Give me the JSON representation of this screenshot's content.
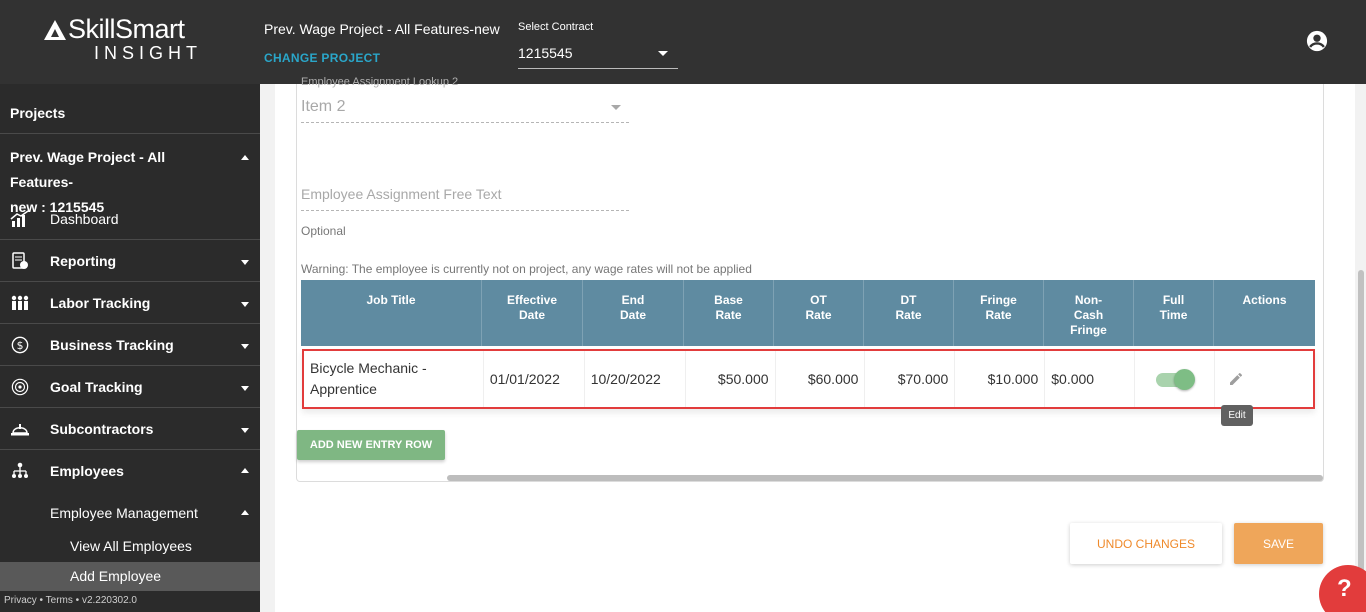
{
  "header": {
    "brand": "SkillSmart",
    "brand_sub": "INSIGHT",
    "project_title": "Prev. Wage Project - All Features-new",
    "change_project": "CHANGE PROJECT",
    "contract_label": "Select Contract",
    "contract_value": "1215545",
    "user_icon": "account-circle-icon"
  },
  "sidebar": {
    "projects_label": "Projects",
    "project_line1": "Prev. Wage Project - All Features-",
    "project_line2": "new : 1215545",
    "items": [
      {
        "label": "Dashboard",
        "icon": "dashboard-chart-icon"
      },
      {
        "label": "Reporting",
        "icon": "report-icon"
      },
      {
        "label": "Labor Tracking",
        "icon": "people-icon"
      },
      {
        "label": "Business Tracking",
        "icon": "dollar-icon"
      },
      {
        "label": "Goal Tracking",
        "icon": "target-icon"
      },
      {
        "label": "Subcontractors",
        "icon": "hardhat-icon"
      },
      {
        "label": "Employees",
        "icon": "org-chart-icon"
      }
    ],
    "employee_management": "Employee Management",
    "view_all_employees": "View All Employees",
    "add_employee": "Add Employee",
    "footer": "Privacy • Terms • v2.220302.0"
  },
  "form": {
    "lookup_label": "Employee Assignment Lookup 2",
    "lookup_value": "Item 2",
    "freetext_placeholder": "Employee Assignment Free Text",
    "optional": "Optional",
    "warning": "Warning: The employee is currently not on project, any wage rates will not be applied"
  },
  "table": {
    "headers": [
      {
        "l1": "Job Title",
        "l2": "",
        "l3": ""
      },
      {
        "l1": "Effective",
        "l2": "Date",
        "l3": ""
      },
      {
        "l1": "End",
        "l2": "Date",
        "l3": ""
      },
      {
        "l1": "Base",
        "l2": "Rate",
        "l3": ""
      },
      {
        "l1": "OT",
        "l2": "Rate",
        "l3": ""
      },
      {
        "l1": "DT",
        "l2": "Rate",
        "l3": ""
      },
      {
        "l1": "Fringe",
        "l2": "Rate",
        "l3": ""
      },
      {
        "l1": "Non-",
        "l2": "Cash",
        "l3": "Fringe"
      },
      {
        "l1": "Full",
        "l2": "Time",
        "l3": ""
      },
      {
        "l1": "Actions",
        "l2": "",
        "l3": ""
      }
    ],
    "row": {
      "job_title_1": "Bicycle Mechanic -",
      "job_title_2": "Apprentice",
      "effective_date": "01/01/2022",
      "end_date": "10/20/2022",
      "base_rate": "$50.000",
      "ot_rate": "$60.000",
      "dt_rate": "$70.000",
      "fringe_rate": "$10.000",
      "non_cash_fringe": "$0.000",
      "full_time": true
    },
    "edit_tooltip": "Edit"
  },
  "buttons": {
    "add_row": "ADD NEW ENTRY ROW",
    "undo": "UNDO CHANGES",
    "save": "SAVE",
    "help": "?"
  },
  "colors": {
    "header_bg": "#323232",
    "sidebar_bg": "#2b2b2b",
    "table_header": "#5f8ba1",
    "accent_teal": "#2aa6c9",
    "accent_orange": "#ef8a2b",
    "green_button": "#7fb783",
    "highlight_red": "#e23c3c"
  }
}
